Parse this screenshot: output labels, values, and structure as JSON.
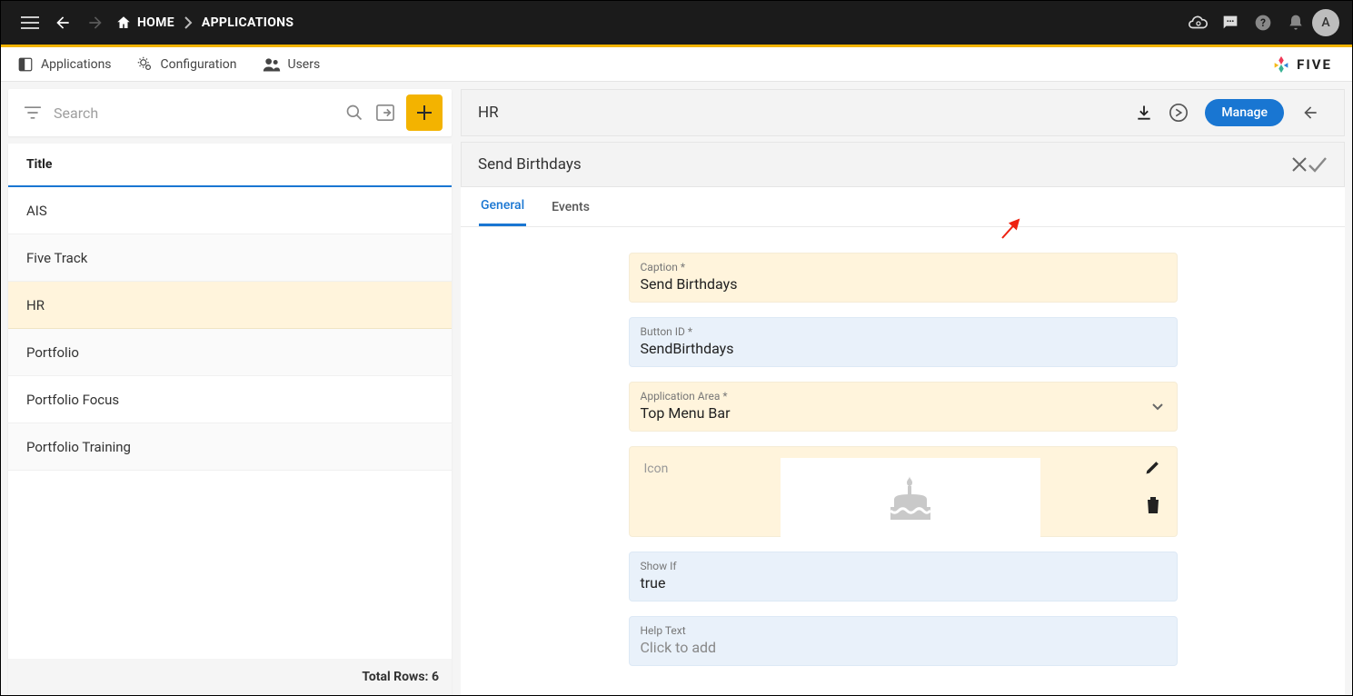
{
  "topbar": {
    "home_label": "HOME",
    "applications_label": "APPLICATIONS",
    "avatar_letter": "A"
  },
  "subnav": {
    "applications": "Applications",
    "configuration": "Configuration",
    "users": "Users",
    "logo_text": "FIVE"
  },
  "search": {
    "placeholder": "Search"
  },
  "list": {
    "header": "Title",
    "rows": [
      "AIS",
      "Five Track",
      "HR",
      "Portfolio",
      "Portfolio Focus",
      "Portfolio Training"
    ],
    "selected_index": 2,
    "footer_label": "Total Rows:",
    "footer_count": "6"
  },
  "detail": {
    "app_title": "HR",
    "manage_label": "Manage",
    "section_title": "Send Birthdays",
    "tabs": {
      "general": "General",
      "events": "Events",
      "active": "general"
    },
    "fields": {
      "caption_label": "Caption *",
      "caption_value": "Send Birthdays",
      "button_id_label": "Button ID *",
      "button_id_value": "SendBirthdays",
      "app_area_label": "Application Area *",
      "app_area_value": "Top Menu Bar",
      "icon_label": "Icon",
      "showif_label": "Show If",
      "showif_value": "true",
      "help_label": "Help Text",
      "help_placeholder": "Click to add"
    }
  }
}
